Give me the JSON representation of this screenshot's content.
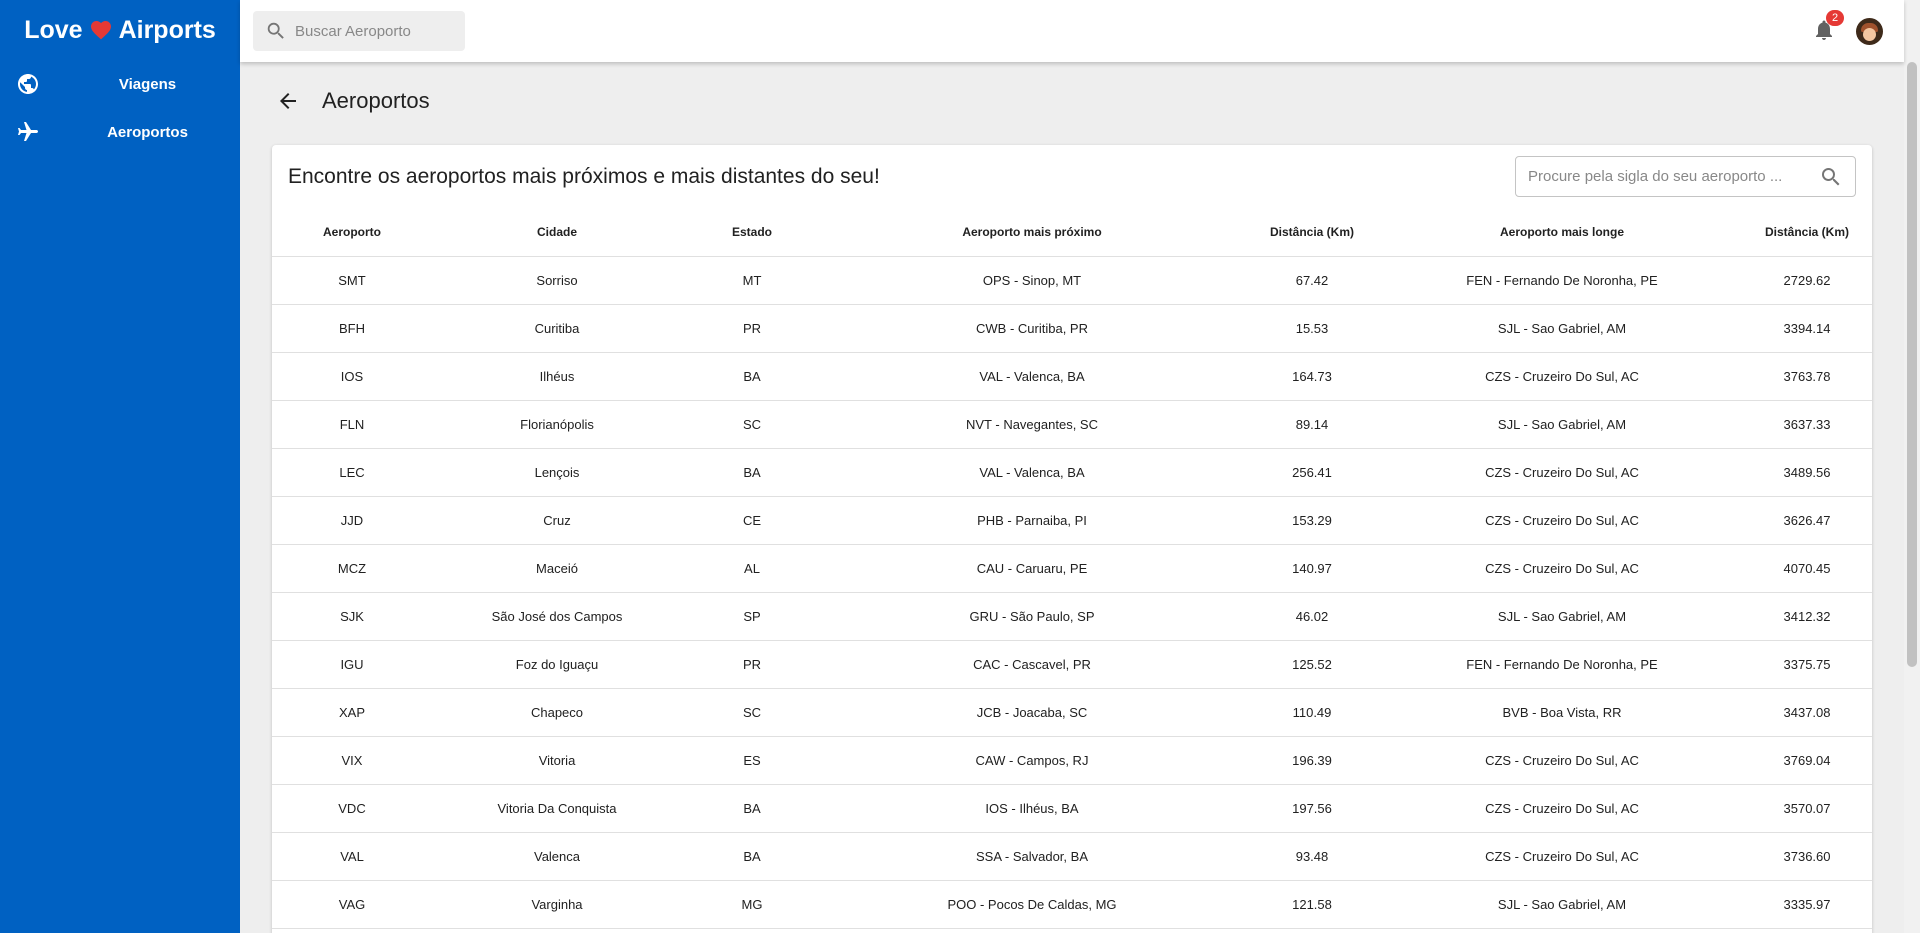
{
  "app": {
    "brand_left": "Love",
    "brand_right": "Airports",
    "colors": {
      "sidebar": "#0061c2",
      "heart": "#e53935",
      "badge": "#e53935"
    }
  },
  "sidebar": {
    "items": [
      {
        "label": "Viagens",
        "icon": "globe-icon"
      },
      {
        "label": "Aeroportos",
        "icon": "airplane-icon"
      }
    ]
  },
  "topbar": {
    "search_placeholder": "Buscar Aeroporto",
    "notifications_count": "2"
  },
  "page": {
    "title": "Aeroportos"
  },
  "card": {
    "title": "Encontre os aeroportos mais próximos e mais distantes do seu!",
    "search_placeholder": "Procure pela sigla do seu aeroporto ..."
  },
  "table": {
    "headers": [
      "Aeroporto",
      "Cidade",
      "Estado",
      "Aeroporto mais próximo",
      "Distância (Km)",
      "Aeroporto mais longe",
      "Distância (Km)"
    ],
    "rows": [
      [
        "SMT",
        "Sorriso",
        "MT",
        "OPS - Sinop, MT",
        "67.42",
        "FEN - Fernando De Noronha, PE",
        "2729.62"
      ],
      [
        "BFH",
        "Curitiba",
        "PR",
        "CWB - Curitiba, PR",
        "15.53",
        "SJL - Sao Gabriel, AM",
        "3394.14"
      ],
      [
        "IOS",
        "Ilhéus",
        "BA",
        "VAL - Valenca, BA",
        "164.73",
        "CZS - Cruzeiro Do Sul, AC",
        "3763.78"
      ],
      [
        "FLN",
        "Florianópolis",
        "SC",
        "NVT - Navegantes, SC",
        "89.14",
        "SJL - Sao Gabriel, AM",
        "3637.33"
      ],
      [
        "LEC",
        "Lençois",
        "BA",
        "VAL - Valenca, BA",
        "256.41",
        "CZS - Cruzeiro Do Sul, AC",
        "3489.56"
      ],
      [
        "JJD",
        "Cruz",
        "CE",
        "PHB - Parnaiba, PI",
        "153.29",
        "CZS - Cruzeiro Do Sul, AC",
        "3626.47"
      ],
      [
        "MCZ",
        "Maceió",
        "AL",
        "CAU - Caruaru, PE",
        "140.97",
        "CZS - Cruzeiro Do Sul, AC",
        "4070.45"
      ],
      [
        "SJK",
        "São José dos Campos",
        "SP",
        "GRU - São Paulo, SP",
        "46.02",
        "SJL - Sao Gabriel, AM",
        "3412.32"
      ],
      [
        "IGU",
        "Foz do Iguaçu",
        "PR",
        "CAC - Cascavel, PR",
        "125.52",
        "FEN - Fernando De Noronha, PE",
        "3375.75"
      ],
      [
        "XAP",
        "Chapeco",
        "SC",
        "JCB - Joacaba, SC",
        "110.49",
        "BVB - Boa Vista, RR",
        "3437.08"
      ],
      [
        "VIX",
        "Vitoria",
        "ES",
        "CAW - Campos, RJ",
        "196.39",
        "CZS - Cruzeiro Do Sul, AC",
        "3769.04"
      ],
      [
        "VDC",
        "Vitoria Da Conquista",
        "BA",
        "IOS - Ilhéus, BA",
        "197.56",
        "CZS - Cruzeiro Do Sul, AC",
        "3570.07"
      ],
      [
        "VAL",
        "Valenca",
        "BA",
        "SSA - Salvador, BA",
        "93.48",
        "CZS - Cruzeiro Do Sul, AC",
        "3736.60"
      ],
      [
        "VAG",
        "Varginha",
        "MG",
        "POO - Pocos De Caldas, MG",
        "121.58",
        "SJL - Sao Gabriel, AM",
        "3335.97"
      ]
    ]
  }
}
